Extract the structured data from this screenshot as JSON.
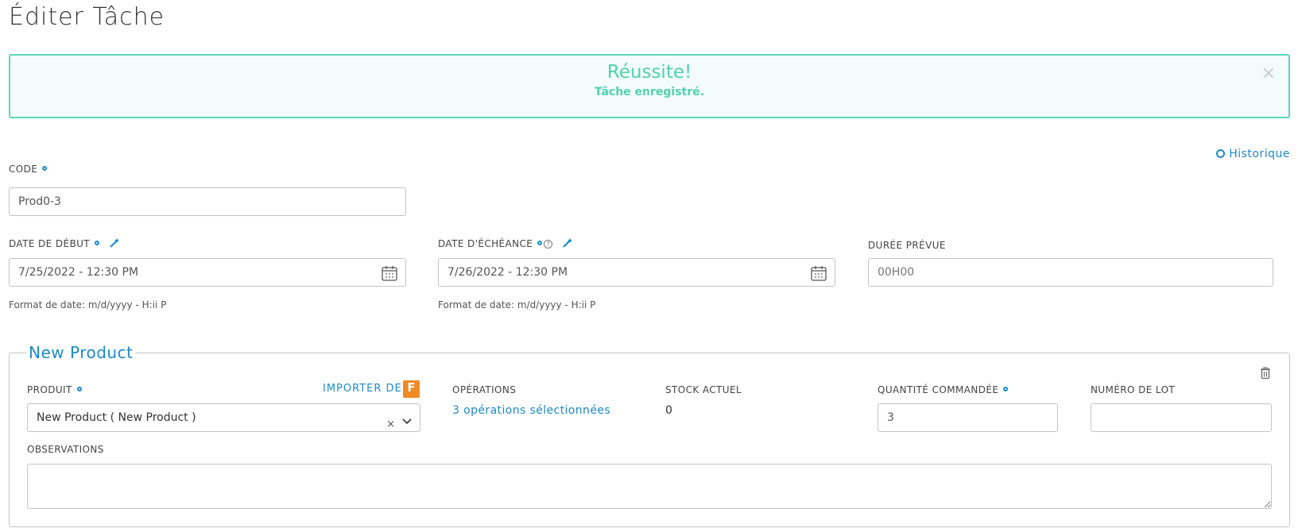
{
  "page": {
    "title": "Éditer Tâche"
  },
  "alert": {
    "title": "Réussite!",
    "message": "Tâche enregistré.",
    "close": "×"
  },
  "history_link": "Historique",
  "code": {
    "label": "CODE",
    "value": "Prod0-3"
  },
  "start_date": {
    "label": "DATE DE DÉBUT",
    "value": "7/25/2022 - 12:30 PM",
    "hint": "Format de date: m/d/yyyy - H:ii P"
  },
  "due_date": {
    "label": "DATE D'ÉCHÉANCE",
    "value": "7/26/2022 - 12:30 PM",
    "hint": "Format de date: m/d/yyyy - H:ii P"
  },
  "duration": {
    "label": "DURÉE PRÉVUE",
    "placeholder": "00H00"
  },
  "product_section": {
    "legend": "New Product",
    "product": {
      "label": "PRODUIT",
      "value": "New Product ( New Product )",
      "clear": "×"
    },
    "import": {
      "label": "IMPORTER DE",
      "badge": "F"
    },
    "operations": {
      "label": "OPÉRATIONS",
      "value": "3 opérations sélectionnées"
    },
    "stock": {
      "label": "STOCK ACTUEL",
      "value": "0"
    },
    "quantity": {
      "label": "QUANTITÉ COMMANDÉE",
      "value": "3"
    },
    "lot": {
      "label": "NUMÉRO DE LOT",
      "value": ""
    },
    "observations": {
      "label": "OBSERVATIONS",
      "value": ""
    }
  },
  "colors": {
    "accent": "#1a8bc9",
    "success": "#4fd1b2",
    "border": "#c4c4c4"
  }
}
